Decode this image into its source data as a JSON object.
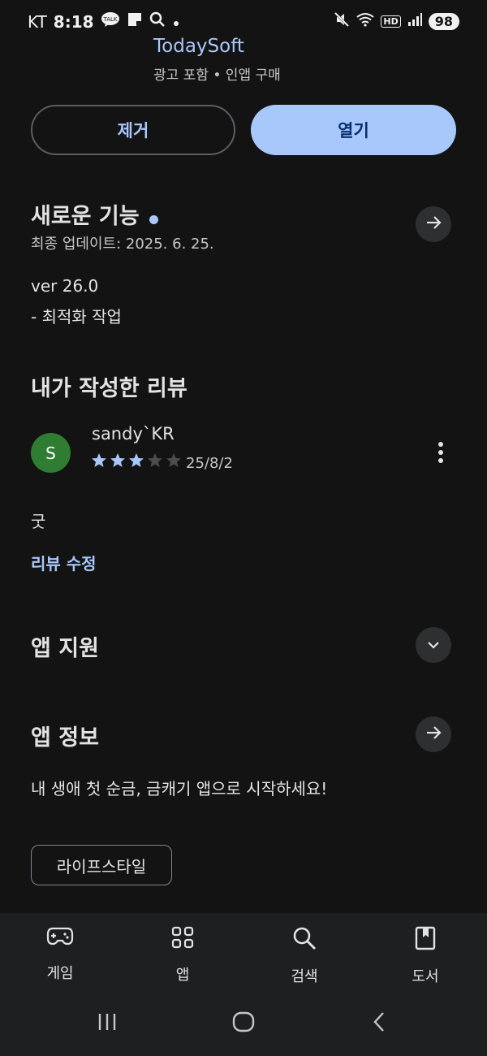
{
  "status_bar": {
    "carrier": "KT",
    "time": "8:18",
    "talk_badge": "TALK",
    "battery": "98",
    "hd_label": "HD"
  },
  "header": {
    "developer": "TodaySoft",
    "meta": "광고 포함 • 인앱 구매"
  },
  "actions": {
    "uninstall_label": "제거",
    "open_label": "열기"
  },
  "whats_new": {
    "title": "새로운 기능",
    "last_updated": "최종 업데이트: 2025. 6. 25.",
    "version": "ver 26.0",
    "notes": "- 최적화 작업"
  },
  "my_review": {
    "title": "내가 작성한 리뷰",
    "avatar_letter": "S",
    "user": "sandy`KR",
    "rating": 3,
    "max_rating": 5,
    "date": "25/8/2",
    "text": "굿",
    "edit_label": "리뷰 수정"
  },
  "app_support": {
    "title": "앱 지원"
  },
  "app_info": {
    "title": "앱 정보",
    "description": "내 생애 첫 순금, 금캐기 앱으로 시작하세요!",
    "category": "라이프스타일"
  },
  "bottom_nav": {
    "games": "게임",
    "apps": "앱",
    "search": "검색",
    "books": "도서"
  },
  "colors": {
    "background": "#131314",
    "accent": "#a8c7fa",
    "avatar": "#2e7d32"
  },
  "icons": [
    "talk-icon",
    "notes-icon",
    "search-icon",
    "mute-icon",
    "wifi-icon",
    "signal-icon",
    "arrow-right-icon",
    "chevron-down-icon",
    "more-vert-icon",
    "star-icon",
    "gamepad-icon",
    "apps-grid-icon",
    "book-icon",
    "recents-icon",
    "home-icon",
    "back-icon"
  ]
}
